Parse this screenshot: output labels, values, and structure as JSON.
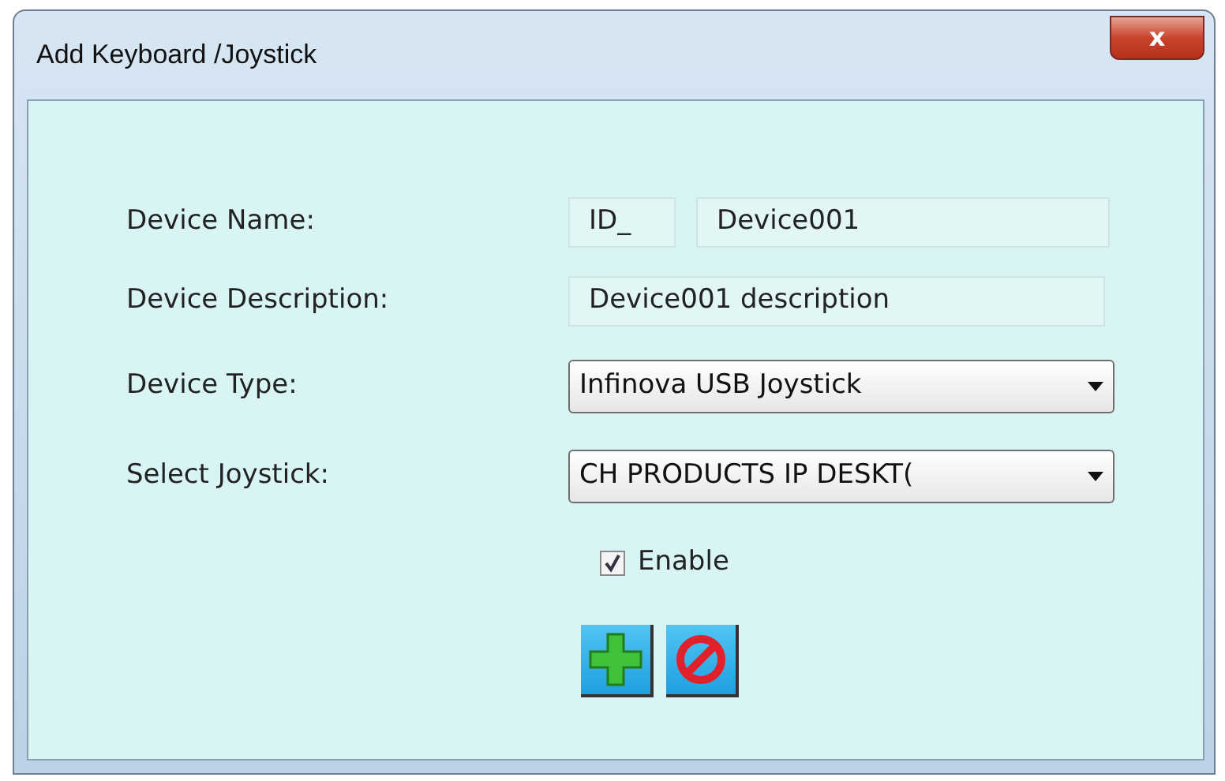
{
  "window": {
    "title": "Add Keyboard /Joystick",
    "close": "x"
  },
  "fields": [
    {
      "label": "Device Name:",
      "kind": "text",
      "prefix": "ID_",
      "value": "Device001"
    },
    {
      "label": "Device Description:",
      "kind": "text",
      "value": "Device001 description"
    },
    {
      "label": "Device Type:",
      "kind": "select",
      "value": "Infinova USB Joystick"
    },
    {
      "label": "Select Joystick:",
      "kind": "select",
      "value": "CH PRODUCTS IP DESKT("
    }
  ],
  "enable": {
    "label": "Enable",
    "checked": true
  },
  "buttons": [
    {
      "kind": "add"
    },
    {
      "kind": "cancel"
    }
  ]
}
